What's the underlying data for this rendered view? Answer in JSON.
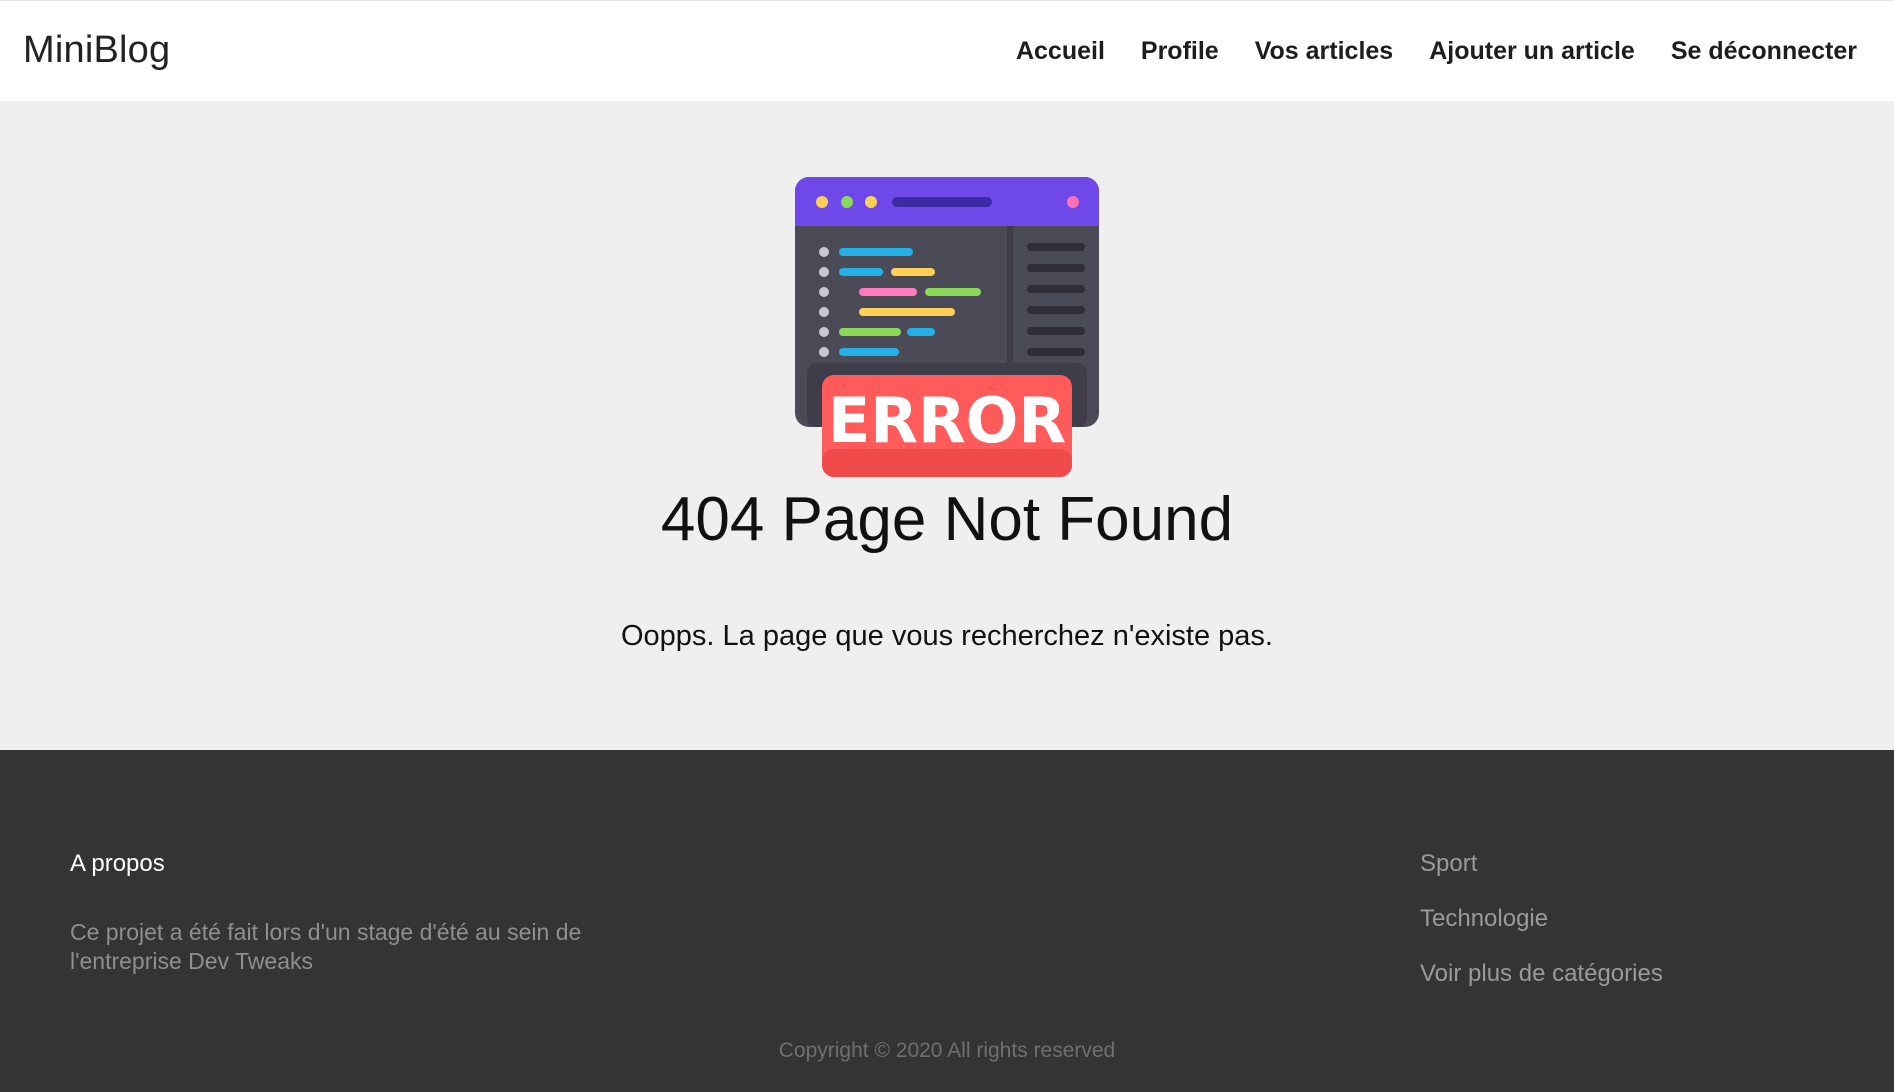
{
  "header": {
    "brand": "MiniBlog",
    "nav": [
      {
        "label": "Accueil"
      },
      {
        "label": "Profile"
      },
      {
        "label": "Vos articles"
      },
      {
        "label": "Ajouter un article"
      },
      {
        "label": "Se déconnecter"
      }
    ]
  },
  "main": {
    "illustration": {
      "icon": "browser-error-illustration",
      "badge_text": "ERROR",
      "colors": {
        "titlebar": "#6f48ea",
        "window": "#4b4a57",
        "badge": "#ff5b5b"
      }
    },
    "title": "404 Page Not Found",
    "message": "Oopps. La page que vous recherchez n'existe pas."
  },
  "footer": {
    "about_heading": "A propos",
    "about_text": "Ce projet a été fait lors d'un stage d'été au sein de l'entreprise Dev Tweaks",
    "links": [
      {
        "label": "Sport"
      },
      {
        "label": "Technologie"
      },
      {
        "label": "Voir plus de catégories"
      }
    ],
    "copyright": "Copyright © 2020 All rights reserved"
  }
}
